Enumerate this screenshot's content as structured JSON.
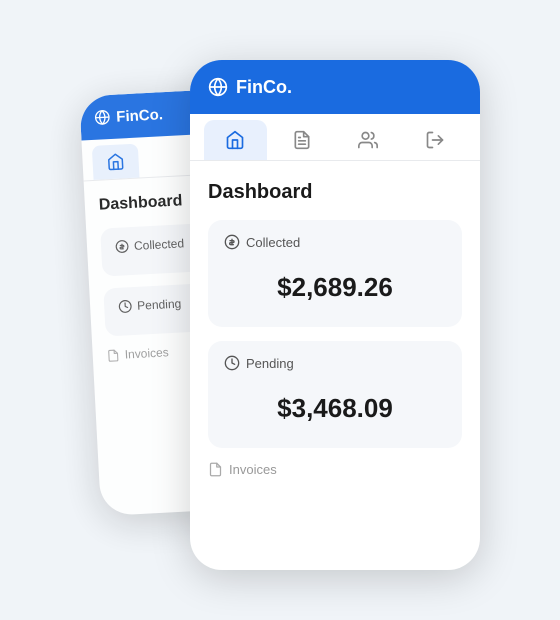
{
  "app": {
    "title": "FinCo.",
    "brand_color": "#1a6be0"
  },
  "nav": {
    "tabs": [
      {
        "id": "home",
        "label": "Home",
        "active": true
      },
      {
        "id": "documents",
        "label": "Documents",
        "active": false
      },
      {
        "id": "team",
        "label": "Team",
        "active": false
      },
      {
        "id": "logout",
        "label": "Logout",
        "active": false
      }
    ]
  },
  "dashboard": {
    "title": "Dashboard",
    "cards": [
      {
        "id": "collected",
        "label": "Collected",
        "value": "$2,689.26",
        "icon": "dollar-circle"
      },
      {
        "id": "pending",
        "label": "Pending",
        "value": "$3,468.09",
        "icon": "clock"
      }
    ],
    "bottom_link": "Invoices"
  }
}
